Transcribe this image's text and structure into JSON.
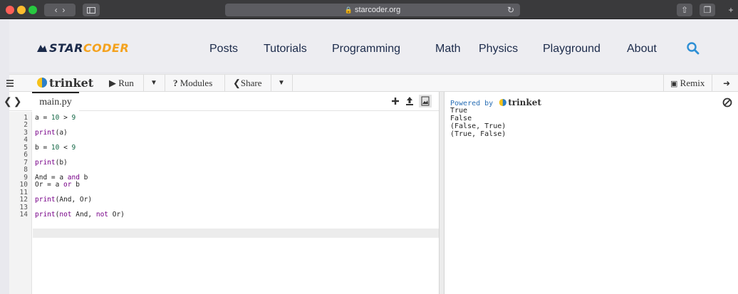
{
  "browser": {
    "url": "starcoder.org",
    "colors": {
      "close": "#fe5f57",
      "minimize": "#febc2e",
      "zoom": "#28c840"
    }
  },
  "site": {
    "logo_main": "STAR",
    "logo_accent": "CODER",
    "nav": [
      "Posts",
      "Tutorials",
      "Programming",
      "Math",
      "Physics",
      "Playground",
      "About"
    ],
    "accent_color": "#2d8fd5"
  },
  "trinket_toolbar": {
    "logo": "trinket",
    "run": "Run",
    "modules": "Modules",
    "share": "Share",
    "remix": "Remix"
  },
  "editor": {
    "file_tab": "main.py",
    "line_numbers": [
      "1",
      "2",
      "3",
      "4",
      "5",
      "6",
      "7",
      "8",
      "9",
      "10",
      "11",
      "12",
      "13",
      "14"
    ],
    "lines": [
      "a = 10 > 9",
      "",
      "print(a)",
      "",
      "b = 10 < 9",
      "",
      "print(b)",
      "",
      "And = a and b",
      "Or = a or b",
      "",
      "print(And, Or)",
      "",
      "print(not And, not Or)"
    ]
  },
  "output": {
    "powered_by": "Powered by",
    "brand": "trinket",
    "lines": [
      "True",
      "False",
      "(False, True)",
      "(True, False)"
    ]
  }
}
